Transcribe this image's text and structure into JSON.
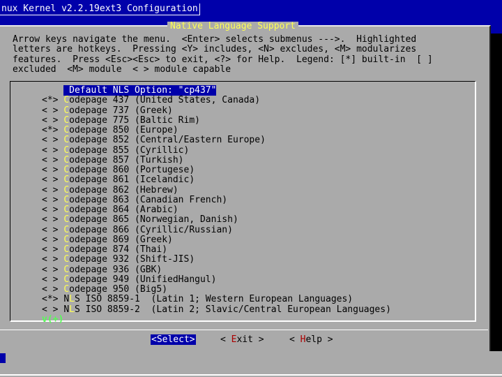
{
  "window": {
    "title": "nux Kernel v2.2.19ext3 Configuration"
  },
  "dialog": {
    "title": "Native Language Support",
    "help_lines": [
      "Arrow keys navigate the menu.  <Enter> selects submenus --->.  Highlighted",
      "letters are hotkeys.  Pressing <Y> includes, <N> excludes, <M> modularizes",
      "features.  Press <Esc><Esc> to exit, <?> for Help.  Legend: [*] built-in  [ ]",
      "excluded  <M> module  < > module capable"
    ]
  },
  "menu": {
    "items": [
      {
        "mark": "   ",
        "hot": "",
        "label": " Default NLS Option: \"cp437\"",
        "selected": true
      },
      {
        "mark": "<*>",
        "hot": "C",
        "label": "odepage 437 (United States, Canada)",
        "selected": false
      },
      {
        "mark": "< >",
        "hot": "C",
        "label": "odepage 737 (Greek)",
        "selected": false
      },
      {
        "mark": "< >",
        "hot": "C",
        "label": "odepage 775 (Baltic Rim)",
        "selected": false
      },
      {
        "mark": "<*>",
        "hot": "C",
        "label": "odepage 850 (Europe)",
        "selected": false
      },
      {
        "mark": "< >",
        "hot": "C",
        "label": "odepage 852 (Central/Eastern Europe)",
        "selected": false
      },
      {
        "mark": "< >",
        "hot": "C",
        "label": "odepage 855 (Cyrillic)",
        "selected": false
      },
      {
        "mark": "< >",
        "hot": "C",
        "label": "odepage 857 (Turkish)",
        "selected": false
      },
      {
        "mark": "< >",
        "hot": "C",
        "label": "odepage 860 (Portugese)",
        "selected": false
      },
      {
        "mark": "< >",
        "hot": "C",
        "label": "odepage 861 (Icelandic)",
        "selected": false
      },
      {
        "mark": "< >",
        "hot": "C",
        "label": "odepage 862 (Hebrew)",
        "selected": false
      },
      {
        "mark": "< >",
        "hot": "C",
        "label": "odepage 863 (Canadian French)",
        "selected": false
      },
      {
        "mark": "< >",
        "hot": "C",
        "label": "odepage 864 (Arabic)",
        "selected": false
      },
      {
        "mark": "< >",
        "hot": "C",
        "label": "odepage 865 (Norwegian, Danish)",
        "selected": false
      },
      {
        "mark": "< >",
        "hot": "C",
        "label": "odepage 866 (Cyrillic/Russian)",
        "selected": false
      },
      {
        "mark": "< >",
        "hot": "C",
        "label": "odepage 869 (Greek)",
        "selected": false
      },
      {
        "mark": "< >",
        "hot": "C",
        "label": "odepage 874 (Thai)",
        "selected": false
      },
      {
        "mark": "< >",
        "hot": "C",
        "label": "odepage 932 (Shift-JIS)",
        "selected": false
      },
      {
        "mark": "< >",
        "hot": "C",
        "label": "odepage 936 (GBK)",
        "selected": false
      },
      {
        "mark": "< >",
        "hot": "C",
        "label": "odepage 949 (UnifiedHangul)",
        "selected": false
      },
      {
        "mark": "< >",
        "hot": "C",
        "label": "odepage 950 (Big5)",
        "selected": false
      },
      {
        "mark": "<*>",
        "hot": "NL",
        "pre": "N",
        "hotchar": "L",
        "label": "S ISO 8859-1  (Latin 1; Western European Languages)",
        "selected": false
      },
      {
        "mark": "< >",
        "hot": "NL",
        "pre": "N",
        "hotchar": "L",
        "label": "S ISO 8859-2  (Latin 2; Slavic/Central European Languages)",
        "selected": false
      }
    ],
    "more_indicator": "v(+)"
  },
  "buttons": {
    "select": {
      "left": "<",
      "hot": "S",
      "rest": "elect",
      "right": ">"
    },
    "exit": {
      "left": "< ",
      "hot": "E",
      "rest": "xit",
      "right": " >"
    },
    "help": {
      "left": "< ",
      "hot": "H",
      "rest": "elp",
      "right": " >"
    }
  },
  "colors": {
    "background": "#0000aa",
    "dialog": "#aaaaaa",
    "title": "#ffff55",
    "hotkey": "#ffff55",
    "selection": "#0000aa",
    "more_indicator": "#55ff55"
  }
}
